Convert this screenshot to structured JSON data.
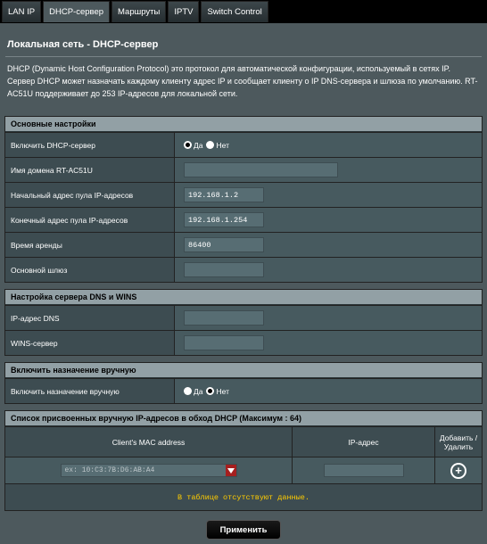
{
  "tabs": [
    {
      "label": "LAN IP"
    },
    {
      "label": "DHCP-сервер"
    },
    {
      "label": "Маршруты"
    },
    {
      "label": "IPTV"
    },
    {
      "label": "Switch Control"
    }
  ],
  "page": {
    "title": "Локальная сеть - DHCP-сервер",
    "description": "DHCP (Dynamic Host Configuration Protocol) это протокол для автоматической конфигурации, используемый в сетях IP. Сервер DHCP может назначать каждому клиенту адрес IP и сообщает клиенту о IP DNS-сервера и шлюза по умолчанию. RT-AC51U поддерживает до 253 IP-адресов для локальной сети."
  },
  "basic": {
    "header": "Основные настройки",
    "enable_dhcp": {
      "label": "Включить DHCP-сервер",
      "yes": "Да",
      "no": "Нет",
      "selected": "yes"
    },
    "domain": {
      "label": "Имя домена RT-AC51U",
      "value": ""
    },
    "start_ip": {
      "label": "Начальный адрес пула IP-адресов",
      "value": "192.168.1.2"
    },
    "end_ip": {
      "label": "Конечный адрес пула IP-адресов",
      "value": "192.168.1.254"
    },
    "lease": {
      "label": "Время аренды",
      "value": "86400"
    },
    "gateway": {
      "label": "Основной шлюз",
      "value": ""
    }
  },
  "dns": {
    "header": "Настройка сервера DNS и WINS",
    "dns_ip": {
      "label": "IP-адрес DNS",
      "value": ""
    },
    "wins": {
      "label": "WINS-сервер",
      "value": ""
    }
  },
  "manual": {
    "header": "Включить назначение вручную",
    "enable": {
      "label": "Включить назначение вручную",
      "yes": "Да",
      "no": "Нет",
      "selected": "no"
    }
  },
  "list": {
    "header": "Список присвоенных вручную IP-адресов в обход DHCP (Максимум : 64)",
    "col_mac": "Client's MAC address",
    "col_ip": "IP-адрес",
    "col_add": "Добавить / Удалить",
    "mac_placeholder": "ex: 10:C3:7B:D6:AB:A4",
    "ip_value": "",
    "no_data": "В таблице отсутствуют данные."
  },
  "apply_label": "Применить",
  "icons": {
    "add": "plus-circle-icon",
    "dropdown": "chevron-down-icon"
  },
  "colors": {
    "panel": "#4d595d",
    "section_header": "#92a0a5",
    "no_data": "#ffcc00",
    "dropdown_accent": "#a51f1f"
  }
}
